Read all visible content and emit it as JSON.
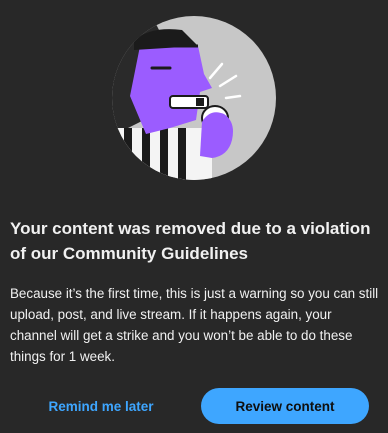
{
  "dialog": {
    "illustration": "referee-whistle-illustration",
    "title": "Your content was removed due to a violation of our Community Guidelines",
    "body": "Because it’s the first time, this is just a warning so you can still upload, post, and live stream. If it happens again, your channel will get a strike and you won’t be able to do these things for 1 week.",
    "secondary_button_label": "Remind me later",
    "primary_button_label": "Review content"
  },
  "colors": {
    "background": "#282828",
    "text": "#f1f1f1",
    "accent": "#3ea6ff",
    "illustration_circle": "#c7c7c7",
    "illustration_purple": "#9b5cff",
    "illustration_dark": "#1b1b1b"
  }
}
